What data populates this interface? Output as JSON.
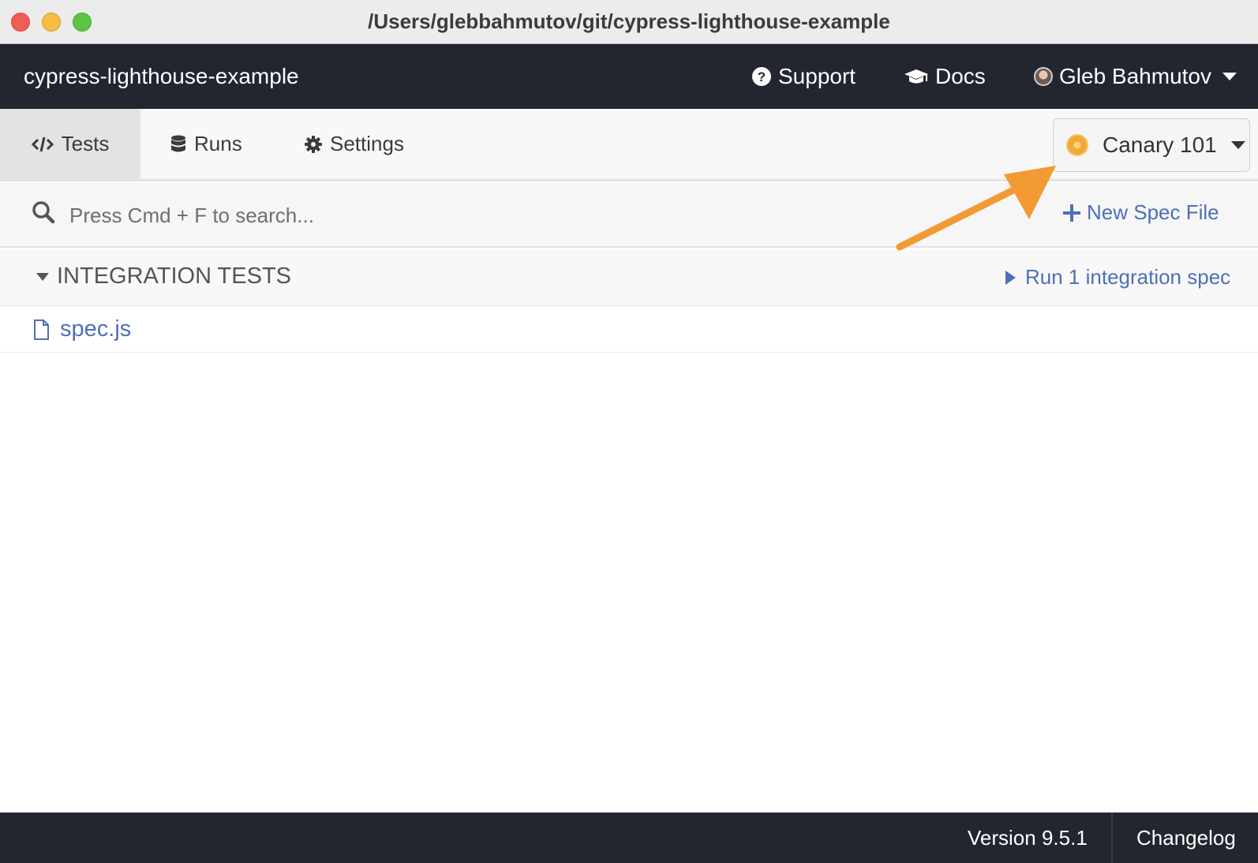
{
  "window": {
    "title": "/Users/glebbahmutov/git/cypress-lighthouse-example"
  },
  "header": {
    "project_name": "cypress-lighthouse-example",
    "support_label": "Support",
    "docs_label": "Docs",
    "user_name": "Gleb Bahmutov",
    "icons": {
      "support": "question-circle-icon",
      "docs": "graduation-cap-icon",
      "avatar": "user-avatar"
    }
  },
  "nav": {
    "tabs": [
      {
        "label": "Tests",
        "icon": "code-icon",
        "active": true
      },
      {
        "label": "Runs",
        "icon": "database-icon",
        "active": false
      },
      {
        "label": "Settings",
        "icon": "gear-icon",
        "active": false
      }
    ],
    "browser": {
      "label": "Canary 101",
      "icon": "chrome-canary-icon"
    }
  },
  "search": {
    "placeholder": "Press Cmd + F to search...",
    "value": "",
    "new_spec_label": "New Spec File"
  },
  "specs": {
    "section_label": "INTEGRATION TESTS",
    "run_all_label": "Run 1 integration spec",
    "files": [
      {
        "name": "spec.js",
        "icon": "file-icon"
      }
    ]
  },
  "footer": {
    "version": "Version 9.5.1",
    "changelog_label": "Changelog"
  },
  "colors": {
    "header_bg": "#23252f",
    "link_blue": "#4e6fb7",
    "annotation_orange": "#f39a34"
  }
}
